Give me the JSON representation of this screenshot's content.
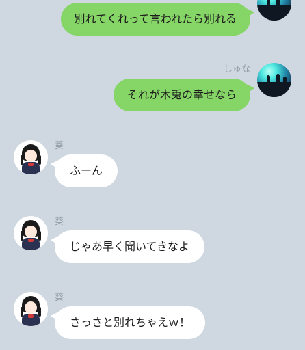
{
  "colors": {
    "background": "#cfd8e0",
    "outgoing_bubble": "#86d567",
    "incoming_bubble": "#ffffff",
    "name_text": "#8f9ba6"
  },
  "messages": [
    {
      "direction": "outgoing",
      "sender": "",
      "text": "別れてくれって言われたら別れる",
      "avatar": "concert-crowd-avatar"
    },
    {
      "direction": "outgoing",
      "sender": "しゅな",
      "text": "それが木兎の幸せなら",
      "avatar": "concert-crowd-avatar"
    },
    {
      "direction": "incoming",
      "sender": "葵",
      "text": "ふーん",
      "avatar": "schoolgirl-avatar"
    },
    {
      "direction": "incoming",
      "sender": "葵",
      "text": "じゃあ早く聞いてきなよ",
      "avatar": "schoolgirl-avatar"
    },
    {
      "direction": "incoming",
      "sender": "葵",
      "text": "さっさと別れちゃえｗ！",
      "avatar": "schoolgirl-avatar"
    }
  ]
}
